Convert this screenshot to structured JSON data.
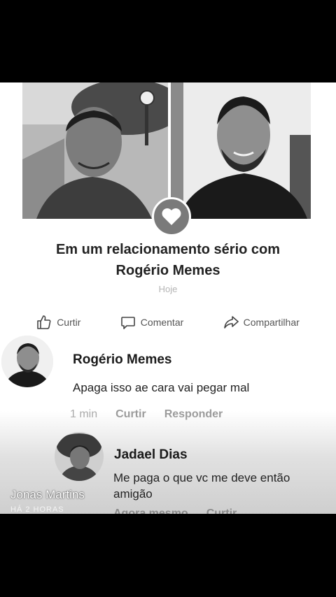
{
  "relationship": {
    "line1": "Em um relacionamento sério com",
    "partner": "Rogério Memes",
    "date": "Hoje"
  },
  "actions": {
    "like": "Curtir",
    "comment": "Comentar",
    "share": "Compartilhar"
  },
  "comments": [
    {
      "author": "Rogério Memes",
      "text": "Apaga isso ae cara vai pegar mal",
      "time": "1 min",
      "like": "Curtir",
      "reply": "Responder"
    },
    {
      "author": "Jadael Dias",
      "text_line1": "Me paga o que vc me deve então",
      "text_line2": "amigão",
      "time": "Agora mesmo",
      "like": "Curtir"
    }
  ],
  "watermark": {
    "name": "Jonas Martins",
    "sub": "HÁ 2 HORAS"
  },
  "colors": {
    "background": "#000000",
    "card": "#ffffff",
    "heart_badge": "#7a7a7a"
  }
}
